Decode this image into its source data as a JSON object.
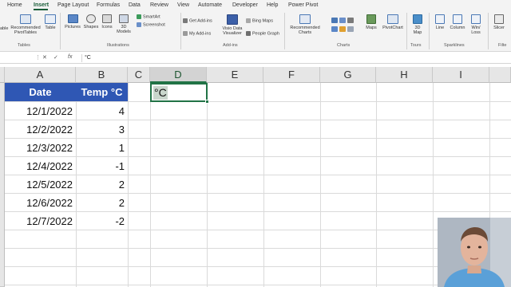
{
  "menu": {
    "tabs": [
      "Home",
      "Insert",
      "Page Layout",
      "Formulas",
      "Data",
      "Review",
      "View",
      "Automate",
      "Developer",
      "Help",
      "Power Pivot"
    ],
    "active_tab": "Insert"
  },
  "ribbon": {
    "tables": {
      "pivot": "able",
      "rec_pivot_1": "Recommended",
      "rec_pivot_2": "PivotTables",
      "table": "Table",
      "label": "Tables"
    },
    "illustrations": {
      "pictures": "Pictures",
      "shapes": "Shapes",
      "icons": "Icons",
      "models_1": "3D",
      "models_2": "Models",
      "smartart": "SmartArt",
      "screenshot": "Screenshot",
      "label": "Illustrations"
    },
    "addins": {
      "get": "Get Add-ins",
      "my": "My Add-ins",
      "visio_1": "Visio Data",
      "visio_2": "Visualizer",
      "bing": "Bing Maps",
      "people": "People Graph",
      "label": "Add-ins"
    },
    "charts": {
      "rec_1": "Recommended",
      "rec_2": "Charts",
      "maps": "Maps",
      "pivotchart": "PivotChart",
      "label": "Charts"
    },
    "tours": {
      "map_1": "3D",
      "map_2": "Map",
      "label": "Tours"
    },
    "sparklines": {
      "line": "Line",
      "column": "Column",
      "winloss_1": "Win/",
      "winloss_2": "Loss",
      "label": "Sparklines"
    },
    "filters": {
      "slicer": "Slicer",
      "label": "Filte"
    }
  },
  "formula_bar": {
    "cancel": "✕",
    "enter": "✓",
    "fx": "fx",
    "value": "°C"
  },
  "sheet": {
    "columns": [
      "A",
      "B",
      "C",
      "D",
      "E",
      "F",
      "G",
      "H",
      "I"
    ],
    "header": {
      "date": "Date",
      "temp": "Temp °C"
    },
    "rows": [
      {
        "date": "12/1/2022",
        "temp": "4"
      },
      {
        "date": "12/2/2022",
        "temp": "3"
      },
      {
        "date": "12/3/2022",
        "temp": "1"
      },
      {
        "date": "12/4/2022",
        "temp": "-1"
      },
      {
        "date": "12/5/2022",
        "temp": "2"
      },
      {
        "date": "12/6/2022",
        "temp": "2"
      },
      {
        "date": "12/7/2022",
        "temp": "-2"
      }
    ],
    "active_cell_value": "°C",
    "header_fill": "#2f57b4",
    "accent": "#217346"
  }
}
